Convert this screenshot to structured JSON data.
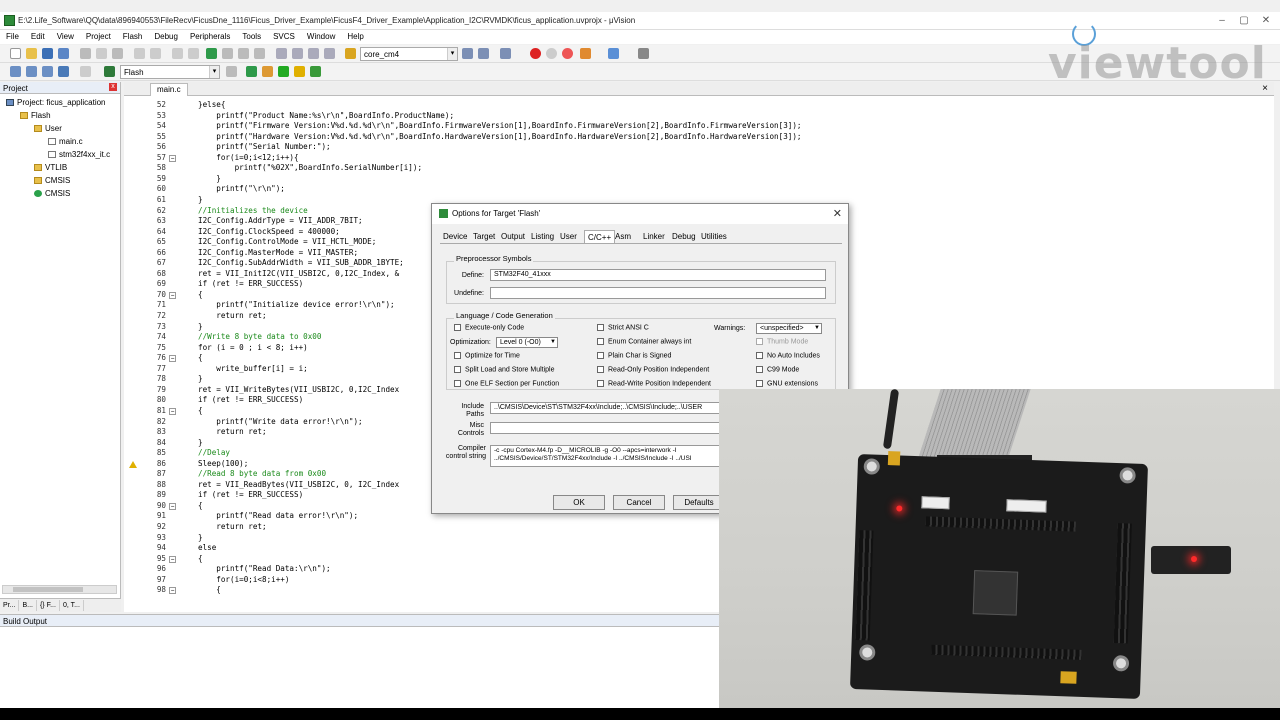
{
  "window": {
    "title": "E:\\2.Life_Software\\QQ\\data\\896940553\\FileRecv\\FicusDne_1116\\Ficus_Driver_Example\\FicusF4_Driver_Example\\Application_I2C\\RVMDK\\ficus_application.uvprojx - μVision"
  },
  "menu": [
    "File",
    "Edit",
    "View",
    "Project",
    "Flash",
    "Debug",
    "Peripherals",
    "Tools",
    "SVCS",
    "Window",
    "Help"
  ],
  "toolbar": {
    "target_combo": "core_cm4",
    "target_select": "Flash"
  },
  "watermark": "viewtool",
  "project_panel": {
    "title": "Project",
    "items": [
      {
        "label": "Project: ficus_application",
        "icon": "proj"
      },
      {
        "label": "Flash",
        "icon": "folder"
      },
      {
        "label": "User",
        "icon": "folder"
      },
      {
        "label": "main.c",
        "icon": "file"
      },
      {
        "label": "stm32f4xx_it.c",
        "icon": "file"
      },
      {
        "label": "VTLIB",
        "icon": "folder"
      },
      {
        "label": "CMSIS",
        "icon": "folder"
      },
      {
        "label": "CMSIS",
        "icon": "gem"
      }
    ],
    "tabs": [
      "Pr...",
      "B...",
      "{} F...",
      "0, T..."
    ]
  },
  "editor": {
    "tab": "main.c",
    "lines": [
      {
        "n": "52",
        "code": "}else{"
      },
      {
        "n": "53",
        "code": "    printf(\"Product Name:%s\\r\\n\",BoardInfo.ProductName);"
      },
      {
        "n": "54",
        "code": "    printf(\"Firmware Version:V%d.%d.%d\\r\\n\",BoardInfo.FirmwareVersion[1],BoardInfo.FirmwareVersion[2],BoardInfo.FirmwareVersion[3]);"
      },
      {
        "n": "55",
        "code": "    printf(\"Hardware Version:V%d.%d.%d\\r\\n\",BoardInfo.HardwareVersion[1],BoardInfo.HardwareVersion[2],BoardInfo.HardwareVersion[3]);"
      },
      {
        "n": "56",
        "code": "    printf(\"Serial Number:\");"
      },
      {
        "n": "57",
        "code": "    for(i=0;i<12;i++){"
      },
      {
        "n": "58",
        "code": "        printf(\"%02X\",BoardInfo.SerialNumber[i]);"
      },
      {
        "n": "59",
        "code": "    }"
      },
      {
        "n": "60",
        "code": "    printf(\"\\r\\n\");"
      },
      {
        "n": "61",
        "code": "}"
      },
      {
        "n": "62",
        "code": "//Initializes the device",
        "comment": true
      },
      {
        "n": "63",
        "code": "I2C_Config.AddrType = VII_ADDR_7BIT;"
      },
      {
        "n": "64",
        "code": "I2C_Config.ClockSpeed = 400000;"
      },
      {
        "n": "65",
        "code": "I2C_Config.ControlMode = VII_HCTL_MODE;"
      },
      {
        "n": "66",
        "code": "I2C_Config.MasterMode = VII_MASTER;"
      },
      {
        "n": "67",
        "code": "I2C_Config.SubAddrWidth = VII_SUB_ADDR_1BYTE;"
      },
      {
        "n": "68",
        "code": "ret = VII_InitI2C(VII_USBI2C, 0,I2C_Index, &"
      },
      {
        "n": "69",
        "code": "if (ret != ERR_SUCCESS)"
      },
      {
        "n": "70",
        "code": "{"
      },
      {
        "n": "71",
        "code": "    printf(\"Initialize device error!\\r\\n\");"
      },
      {
        "n": "72",
        "code": "    return ret;"
      },
      {
        "n": "73",
        "code": "}"
      },
      {
        "n": "74",
        "code": "//Write 8 byte data to 0x00",
        "comment": true
      },
      {
        "n": "75",
        "code": "for (i = 0 ; i < 8; i++)"
      },
      {
        "n": "76",
        "code": "{"
      },
      {
        "n": "77",
        "code": "    write_buffer[i] = i;"
      },
      {
        "n": "78",
        "code": "}"
      },
      {
        "n": "79",
        "code": "ret = VII_WriteBytes(VII_USBI2C, 0,I2C_Index"
      },
      {
        "n": "80",
        "code": "if (ret != ERR_SUCCESS)"
      },
      {
        "n": "81",
        "code": "{"
      },
      {
        "n": "82",
        "code": "    printf(\"Write data error!\\r\\n\");"
      },
      {
        "n": "83",
        "code": "    return ret;"
      },
      {
        "n": "84",
        "code": "}"
      },
      {
        "n": "85",
        "code": "//Delay",
        "comment": true
      },
      {
        "n": "86",
        "code": "Sleep(100);"
      },
      {
        "n": "87",
        "code": "//Read 8 byte data from 0x00",
        "comment": true
      },
      {
        "n": "88",
        "code": "ret = VII_ReadBytes(VII_USBI2C, 0, I2C_Index"
      },
      {
        "n": "89",
        "code": "if (ret != ERR_SUCCESS)"
      },
      {
        "n": "90",
        "code": "{"
      },
      {
        "n": "91",
        "code": "    printf(\"Read data error!\\r\\n\");"
      },
      {
        "n": "92",
        "code": "    return ret;"
      },
      {
        "n": "93",
        "code": "}"
      },
      {
        "n": "94",
        "code": "else"
      },
      {
        "n": "95",
        "code": "{"
      },
      {
        "n": "96",
        "code": "    printf(\"Read Data:\\r\\n\");"
      },
      {
        "n": "97",
        "code": "    for(i=0;i<8;i++)"
      },
      {
        "n": "98",
        "code": "    {"
      }
    ]
  },
  "build_output": {
    "title": "Build Output"
  },
  "dialog": {
    "title": "Options for Target 'Flash'",
    "tabs": [
      "Device",
      "Target",
      "Output",
      "Listing",
      "User",
      "C/C++",
      "Asm",
      "Linker",
      "Debug",
      "Utilities"
    ],
    "active_tab": "C/C++",
    "preprocessor": {
      "group": "Preprocessor Symbols",
      "define_label": "Define:",
      "define_value": "STM32F40_41xxx",
      "undefine_label": "Undefine:",
      "undefine_value": ""
    },
    "language": {
      "group": "Language / Code Generation",
      "optimization_label": "Optimization:",
      "optimization_value": "Level 0 (-O0)",
      "warnings_label": "Warnings:",
      "warnings_value": "<unspecified>",
      "col1": [
        "Execute-only Code",
        "Optimize for Time",
        "Split Load and Store Multiple",
        "One ELF Section per Function"
      ],
      "col2": [
        "Strict ANSI C",
        "Enum Container always int",
        "Plain Char is Signed",
        "Read-Only Position Independent",
        "Read-Write Position Independent"
      ],
      "col3": [
        "Thumb Mode",
        "No Auto Includes",
        "C99 Mode",
        "GNU extensions"
      ]
    },
    "include_paths_label": "Include Paths",
    "include_paths_value": "..\\CMSIS\\Device\\ST\\STM32F4xx\\Include;..\\CMSIS\\Include;..\\USER",
    "misc_controls_label": "Misc Controls",
    "misc_controls_value": "",
    "compiler_control_label": "Compiler control string",
    "compiler_control_value": "-c -cpu Cortex-M4.fp -D__MICROLIB -g -O0 --apcs=interwork -I\n../CMSIS/Device/ST/STM32F4xx/Include -I ../CMSIS/Include -I ../USI",
    "buttons": {
      "ok": "OK",
      "cancel": "Cancel",
      "defaults": "Defaults"
    }
  }
}
